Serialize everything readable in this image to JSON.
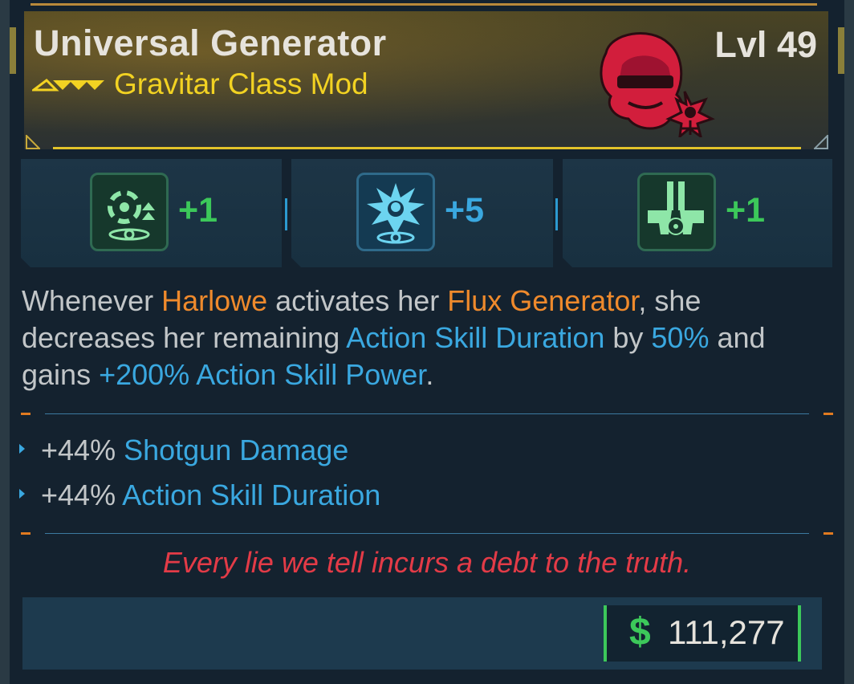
{
  "item": {
    "name": "Universal Generator",
    "type": "Gravitar Class Mod",
    "level": "Lvl 49",
    "rarity_icon": "rarity-chevrons-icon",
    "portrait_icon": "harlowe-portrait-icon"
  },
  "skills": [
    {
      "icon": "gravity-swirl-skill-icon",
      "value": "+1",
      "color": "#3cc85a"
    },
    {
      "icon": "burst-skill-icon",
      "value": "+5",
      "color": "#3aa8e0"
    },
    {
      "icon": "radiation-pistols-skill-icon",
      "value": "+1",
      "color": "#3cc85a"
    }
  ],
  "description": {
    "t1": "Whenever ",
    "harlowe": "Harlowe",
    "t2": " activates her ",
    "flux": "Flux Generator",
    "t3": ", she decreases her remaining ",
    "asd": "Action Skill Duration",
    "t4": " by ",
    "pct": "50%",
    "t5": " and gains ",
    "asp": "+200% Action Skill Power",
    "t6": "."
  },
  "stats": [
    {
      "value": "+44%",
      "label": "Shotgun Damage"
    },
    {
      "value": "+44%",
      "label": "Action Skill Duration"
    }
  ],
  "flavor_text": "Every lie we tell incurs a debt to the truth.",
  "price": {
    "currency_symbol": "$",
    "amount": "111,277"
  },
  "colors": {
    "rarity_gold": "#f2d222",
    "highlight_orange": "#ef8a2c",
    "highlight_blue": "#3aa8e0",
    "flavor_red": "#e33b47",
    "money_green": "#3cc85a"
  }
}
